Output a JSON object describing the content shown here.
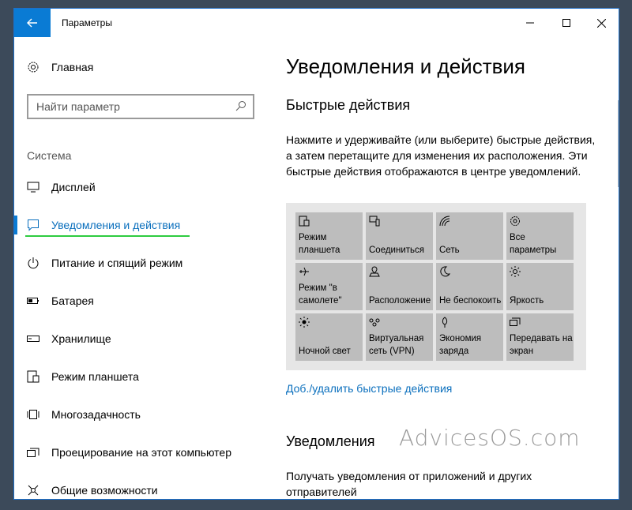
{
  "window": {
    "title": "Параметры"
  },
  "sidebar": {
    "home_label": "Главная",
    "search_placeholder": "Найти параметр",
    "section_label": "Система",
    "items": [
      {
        "label": "Дисплей",
        "icon": "monitor-icon",
        "active": false
      },
      {
        "label": "Уведомления и действия",
        "icon": "notification-icon",
        "active": true
      },
      {
        "label": "Питание и спящий режим",
        "icon": "power-icon",
        "active": false
      },
      {
        "label": "Батарея",
        "icon": "battery-icon",
        "active": false
      },
      {
        "label": "Хранилище",
        "icon": "storage-icon",
        "active": false
      },
      {
        "label": "Режим планшета",
        "icon": "tablet-mode-icon",
        "active": false
      },
      {
        "label": "Многозадачность",
        "icon": "multitasking-icon",
        "active": false
      },
      {
        "label": "Проецирование на этот компьютер",
        "icon": "projection-icon",
        "active": false
      },
      {
        "label": "Общие возможности",
        "icon": "shared-experiences-icon",
        "active": false
      }
    ]
  },
  "main": {
    "title": "Уведомления и действия",
    "quick_actions_heading": "Быстрые действия",
    "quick_actions_description": "Нажмите и удерживайте (или выберите) быстрые действия, а затем перетащите для изменения их расположения. Эти быстрые действия отображаются в центре уведомлений.",
    "tiles": [
      {
        "label": "Режим планшета",
        "icon": "tablet-mode-icon"
      },
      {
        "label": "Соединиться",
        "icon": "connect-icon"
      },
      {
        "label": "Сеть",
        "icon": "network-icon"
      },
      {
        "label": "Все параметры",
        "icon": "settings-icon"
      },
      {
        "label": "Режим \"в самолете\"",
        "icon": "airplane-icon"
      },
      {
        "label": "Расположение",
        "icon": "location-icon"
      },
      {
        "label": "Не беспокоить",
        "icon": "moon-icon"
      },
      {
        "label": "Яркость",
        "icon": "brightness-icon"
      },
      {
        "label": "Ночной свет",
        "icon": "night-light-icon"
      },
      {
        "label": "Виртуальная сеть (VPN)",
        "icon": "vpn-icon"
      },
      {
        "label": "Экономия заряда",
        "icon": "battery-saver-icon"
      },
      {
        "label": "Передавать на экран",
        "icon": "project-icon"
      }
    ],
    "add_remove_link": "Доб./удалить быстрые действия",
    "notifications_heading": "Уведомления",
    "notifications_description": "Получать уведомления от приложений и других отправителей"
  },
  "watermark": "AdvicesOS.com",
  "colors": {
    "accent": "#0a7bd4",
    "link": "#0a6fbd",
    "tile": "#bdbdbd",
    "highlight": "#2ecc40"
  }
}
